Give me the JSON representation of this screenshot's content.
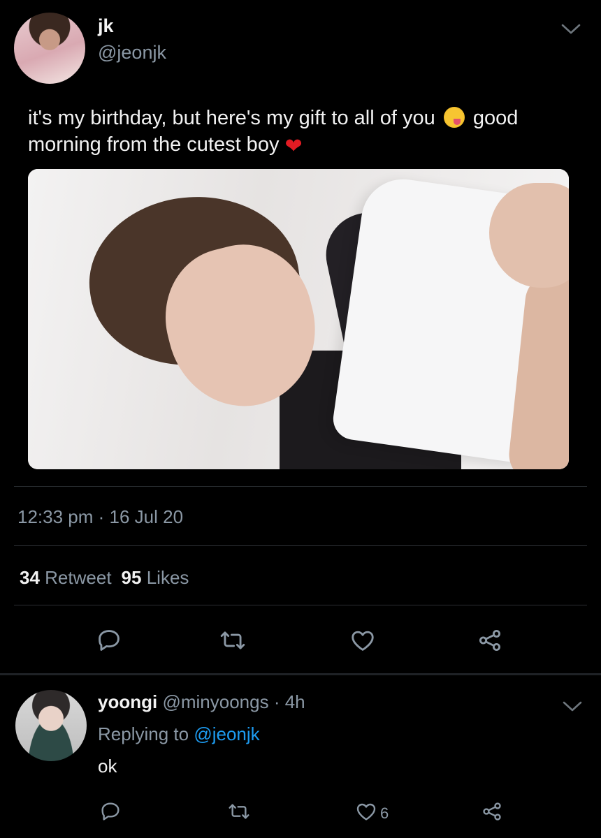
{
  "tweet": {
    "name": "jk",
    "handle": "@jeonjk",
    "text_line1": "it's my birthday, but here's my gift to all of you",
    "text_line1_end": "good",
    "text_line2": "morning from the cutest boy",
    "emoji1": "yum-face",
    "emoji2": "red-heart",
    "heart_glyph": "❤",
    "time": "12:33 pm",
    "date_sep": " · ",
    "date": "16 Jul 20",
    "retweet_count": "34",
    "retweet_label": "Retweet",
    "like_count": "95",
    "like_label": "Likes"
  },
  "reply": {
    "name": "yoongi",
    "handle": "@minyoongs",
    "sep": " · ",
    "time": "4h",
    "replying_label": "Replying to",
    "replying_to": "@jeonjk",
    "text": "ok",
    "like_count": "6"
  },
  "icons": {
    "reply": "speech-bubble-icon",
    "retweet": "retweet-icon",
    "like": "heart-icon",
    "share": "share-icon",
    "menu": "chevron-down-icon"
  },
  "colors": {
    "background": "#000000",
    "text": "#f2f2f2",
    "secondary": "#8b98a5",
    "link": "#1d9bf0"
  }
}
